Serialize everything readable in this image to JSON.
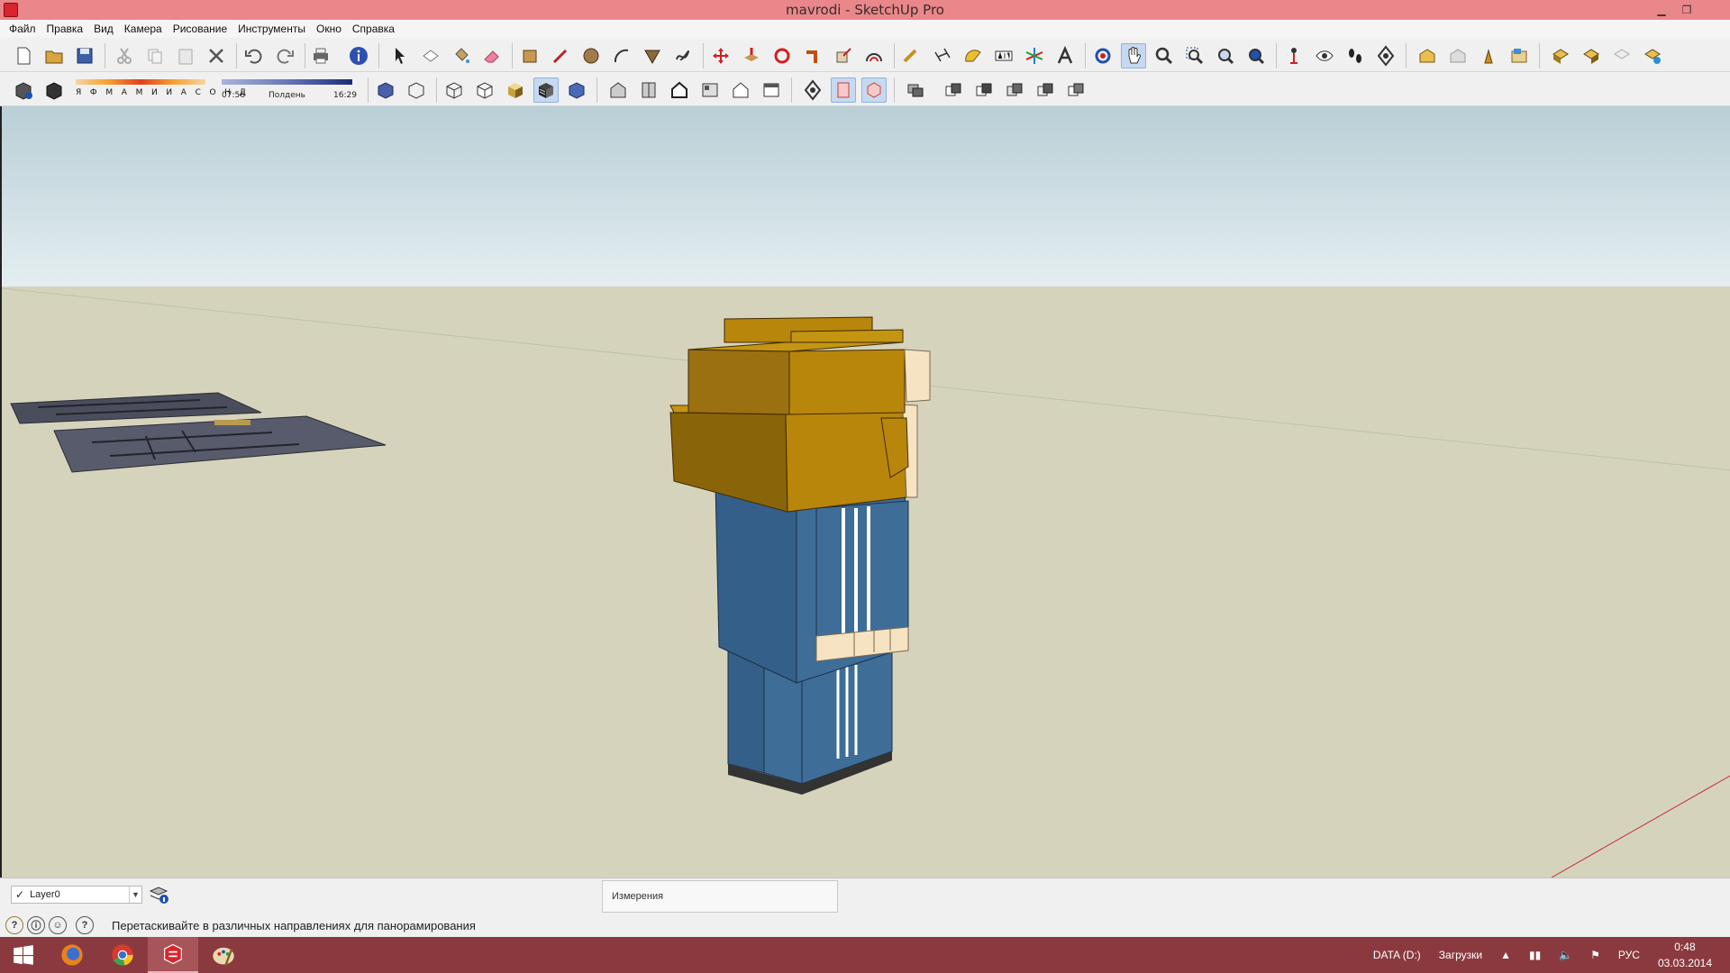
{
  "window": {
    "title": "mavrodi - SketchUp Pro"
  },
  "menu": [
    "Файл",
    "Правка",
    "Вид",
    "Камера",
    "Рисование",
    "Инструменты",
    "Окно",
    "Справка"
  ],
  "shadow": {
    "months": "Я Ф М А М И И А С О Н Д",
    "time_start": "07:56",
    "time_mid": "Полдень",
    "time_end": "16:29"
  },
  "layer": {
    "current": "Layer0"
  },
  "measurements": {
    "label": "Измерения"
  },
  "status": {
    "hint": "Перетаскивайте в различных направлениях для панорамирования"
  },
  "taskbar": {
    "drive": "DATA (D:)",
    "downloads": "Загрузки",
    "language": "РУС",
    "time": "0:48",
    "date": "03.03.2014"
  },
  "colors": {
    "sky": "#cfe0e6",
    "ground": "#d6d3bd",
    "hair": "#b8860b",
    "suit": "#3e6d98",
    "skin": "#f6e3c1",
    "titlebar": "#e9878a",
    "taskbar": "#8a3a3e"
  }
}
